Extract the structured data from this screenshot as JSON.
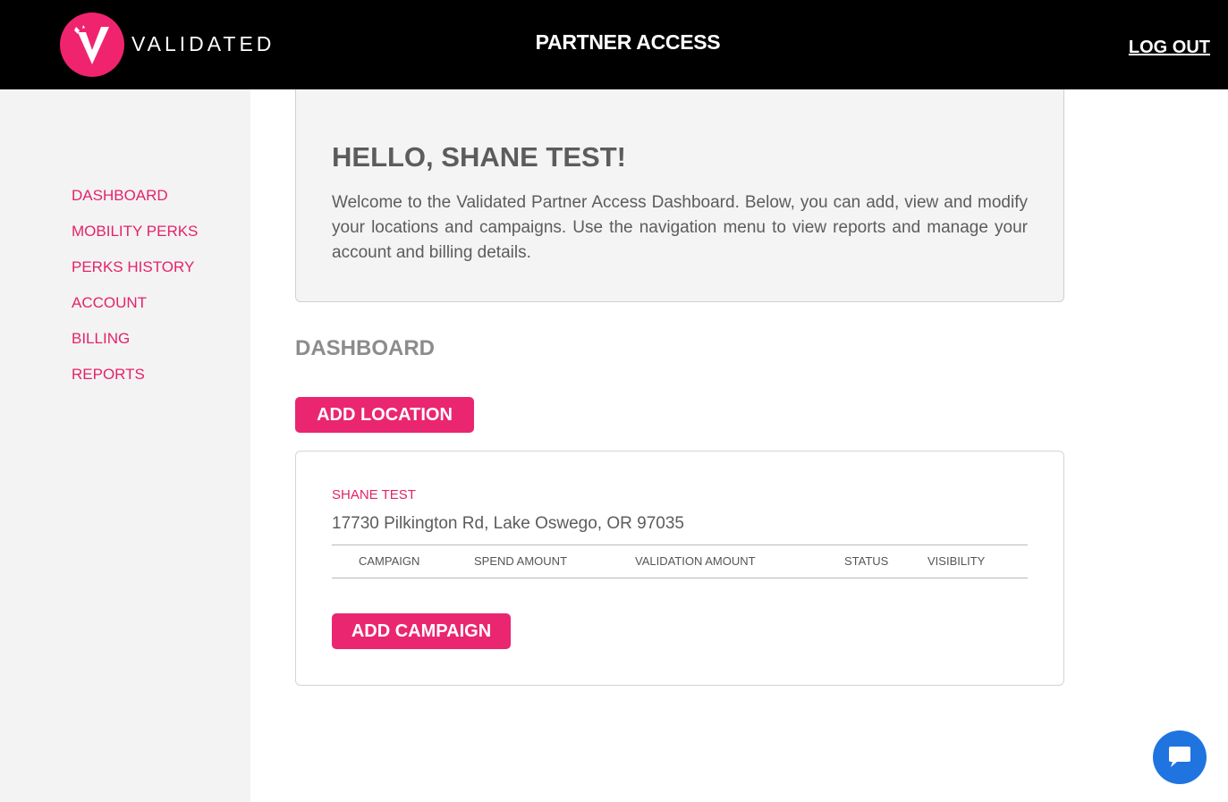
{
  "header": {
    "logo_text": "VALIDATED",
    "title": "PARTNER ACCESS",
    "logout_label": "LOG OUT"
  },
  "sidebar": {
    "items": [
      {
        "label": "DASHBOARD"
      },
      {
        "label": "MOBILITY PERKS"
      },
      {
        "label": "PERKS HISTORY"
      },
      {
        "label": "ACCOUNT"
      },
      {
        "label": "BILLING"
      },
      {
        "label": "REPORTS"
      }
    ]
  },
  "welcome": {
    "greeting": "HELLO, SHANE TEST!",
    "message": "Welcome to the Validated Partner Access Dashboard. Below, you can add, view and modify your locations and campaigns. Use the navigation menu to view reports and manage your account and billing details."
  },
  "dashboard": {
    "title": "DASHBOARD",
    "add_location_label": "ADD LOCATION",
    "location": {
      "name": "SHANE TEST",
      "address": "17730 Pilkington Rd, Lake Oswego, OR 97035",
      "columns": [
        "CAMPAIGN",
        "SPEND AMOUNT",
        "VALIDATION AMOUNT",
        "STATUS",
        "VISIBILITY"
      ],
      "add_campaign_label": "ADD CAMPAIGN"
    }
  },
  "colors": {
    "brand_pink": "#ea2670",
    "header_bg": "#000000",
    "sidebar_bg": "#f3f3f3",
    "chat_blue": "#1f74e0"
  },
  "icons": {
    "logo": "validated-v-logo-icon",
    "chat": "chat-bubble-icon"
  }
}
